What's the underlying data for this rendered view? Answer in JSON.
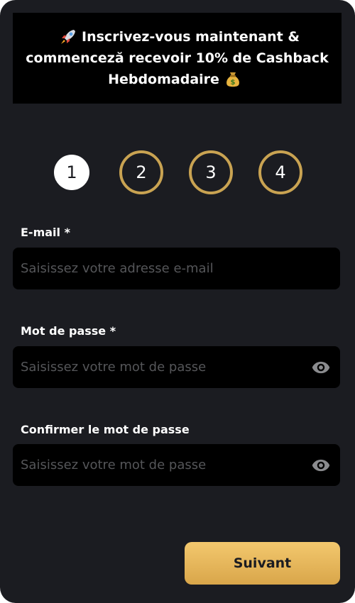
{
  "banner": {
    "line1": "Inscrivez-vous maintenant &",
    "line2": "commenceză recevoir 10% de Cashback",
    "line3": "Hebdomadaire",
    "icons": [
      "rocket-icon",
      "money-bag-icon"
    ]
  },
  "steps": [
    {
      "label": "1",
      "active": true
    },
    {
      "label": "2",
      "active": false
    },
    {
      "label": "3",
      "active": false
    },
    {
      "label": "4",
      "active": false
    }
  ],
  "form": {
    "email": {
      "label": "E-mail *",
      "placeholder": "Saisissez votre adresse e-mail",
      "value": ""
    },
    "password": {
      "label": "Mot de passe *",
      "placeholder": "Saisissez votre mot de passe",
      "value": "",
      "icon": "eye-icon"
    },
    "confirm_password": {
      "label": "Confirmer le mot de passe",
      "placeholder": "Saisissez votre mot de passe",
      "value": "",
      "icon": "eye-icon"
    }
  },
  "next_button": {
    "label": "Suivant"
  },
  "colors": {
    "background": "#1b1c21",
    "field_background": "#000000",
    "accent_gold": "#c9a352",
    "button_gradient_top": "#f3c86e",
    "button_gradient_bottom": "#d9a64a",
    "placeholder": "#555659"
  }
}
